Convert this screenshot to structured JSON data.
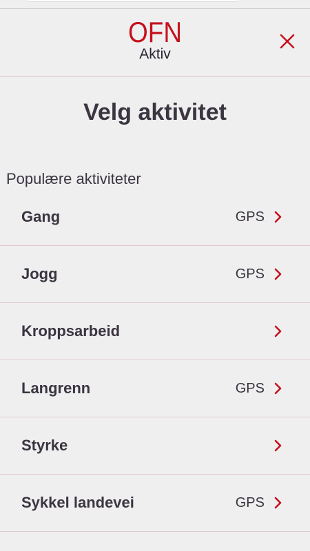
{
  "header": {
    "logo_main": "OFN",
    "logo_sub": "Aktiv",
    "close_icon": "close-icon"
  },
  "title": "Velg aktivitet",
  "section_heading": "Populære aktiviteter",
  "colors": {
    "accent": "#c4121e",
    "text": "#3a3540",
    "background": "#f0eff0",
    "divider": "#e0c8cc"
  },
  "activities": [
    {
      "label": "Gang",
      "badge": "GPS"
    },
    {
      "label": "Jogg",
      "badge": "GPS"
    },
    {
      "label": "Kroppsarbeid",
      "badge": ""
    },
    {
      "label": "Langrenn",
      "badge": "GPS"
    },
    {
      "label": "Styrke",
      "badge": ""
    },
    {
      "label": "Sykkel landevei",
      "badge": "GPS"
    }
  ],
  "chevron_icon": "chevron-right-icon"
}
